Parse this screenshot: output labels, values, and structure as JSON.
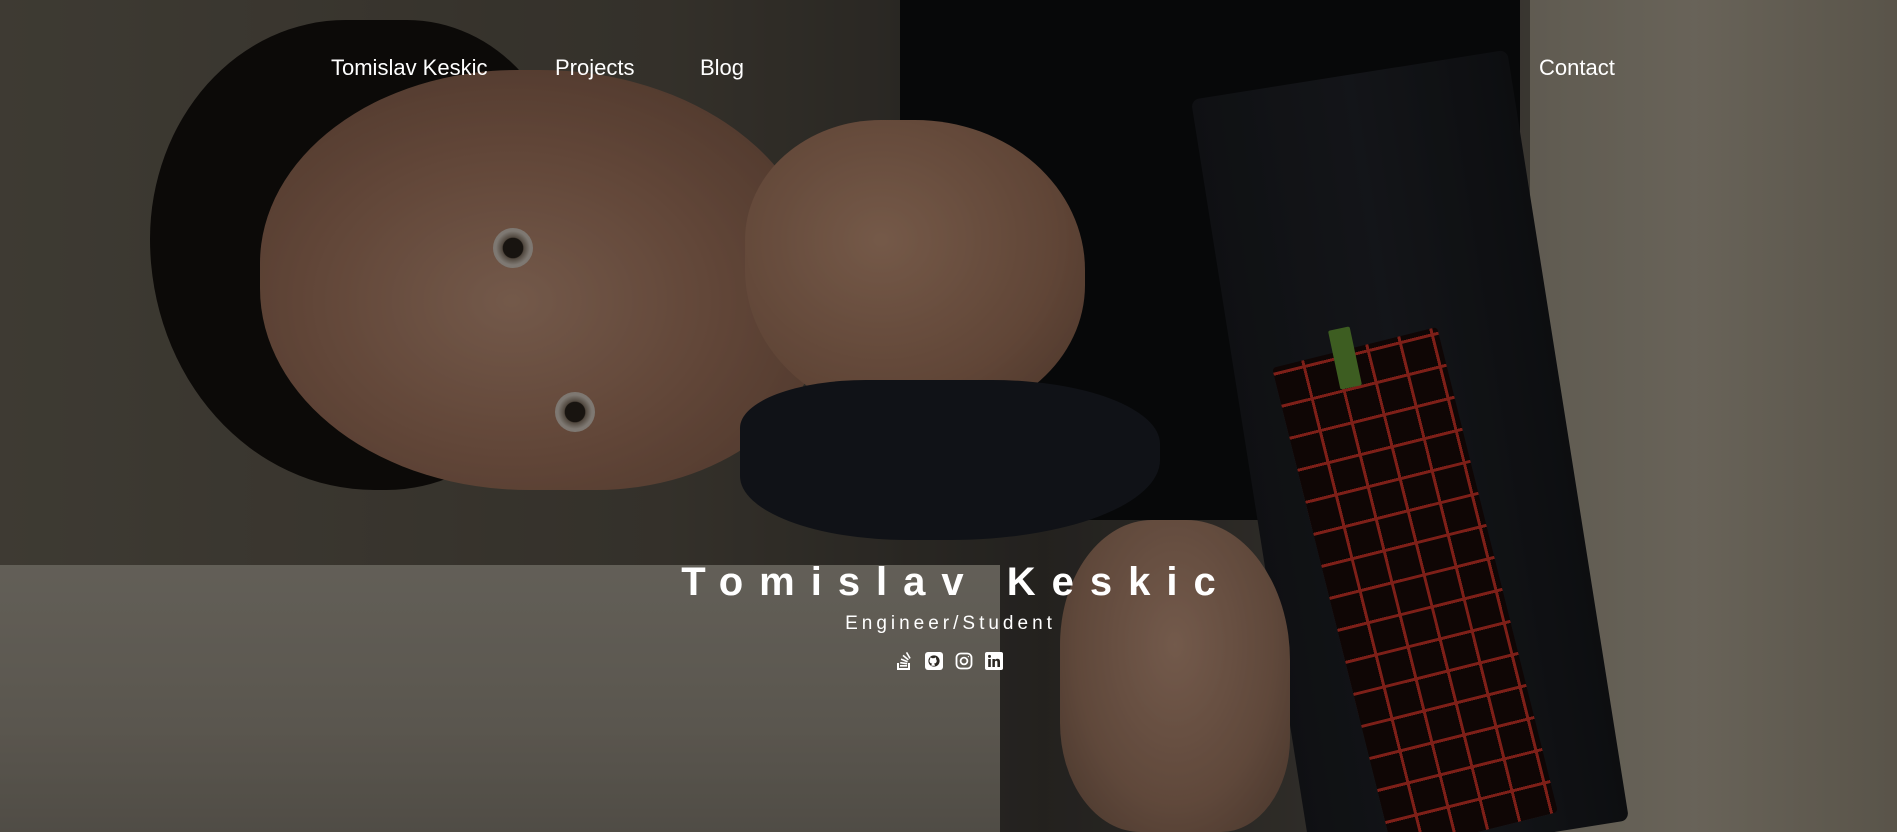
{
  "nav": {
    "brand": "Tomislav Keskic",
    "projects": "Projects",
    "blog": "Blog",
    "contact": "Contact"
  },
  "hero": {
    "name": "Tomislav Keskic",
    "subtitle": "Engineer/Student",
    "socials": [
      {
        "icon": "stack-overflow-icon"
      },
      {
        "icon": "github-icon"
      },
      {
        "icon": "instagram-icon"
      },
      {
        "icon": "linkedin-icon"
      }
    ]
  },
  "colors": {
    "text": "#ffffff",
    "overlay": "rgba(0,0,0,0.42)"
  }
}
